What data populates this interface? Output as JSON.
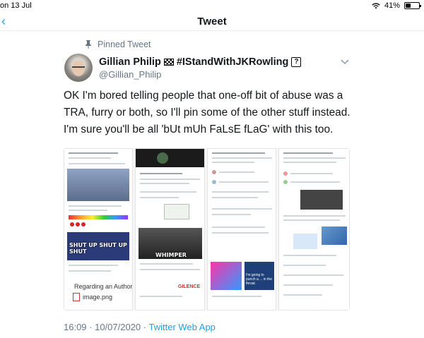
{
  "status_bar": {
    "clock": "on 13 Jul",
    "battery": "41%",
    "battery_level": 0.41
  },
  "nav": {
    "title": "Tweet",
    "back_glyph": "‹"
  },
  "pinned": {
    "label": "Pinned Tweet"
  },
  "author": {
    "name": "Gillian Philip",
    "name_suffix": "#IStandWithJKRowling",
    "hint_glyph": "?",
    "handle": "@Gillian_Philip"
  },
  "tweet": {
    "text": "OK I'm bored telling people that one-off bit of abuse was a TRA, furry or both, so I'll pin some of the other stuff instead. I'm sure you'll be all 'bUt mUh FaLsE fLaG' with this too."
  },
  "media": {
    "meme_1": "SHUT UP SHUT UP SHUT",
    "meme_2": "WHIMPER",
    "panel1_caption": "Regarding an Author",
    "file_name": "image.png",
    "panel3_caption": "I'm going to punch a ... in the throat",
    "panel2_tag": "GILENCE"
  },
  "footer": {
    "time": "16:09 · 10/07/2020",
    "separator": " · ",
    "source": "Twitter Web App"
  },
  "colors": {
    "accent": "#1da1f2",
    "secondary_text": "#657786",
    "divider": "#e6ecf0"
  },
  "icons": {
    "back": "chevron-left-icon",
    "pin": "pin-icon",
    "caret": "chevron-down-icon",
    "flag": "checkered-flag-icon"
  }
}
